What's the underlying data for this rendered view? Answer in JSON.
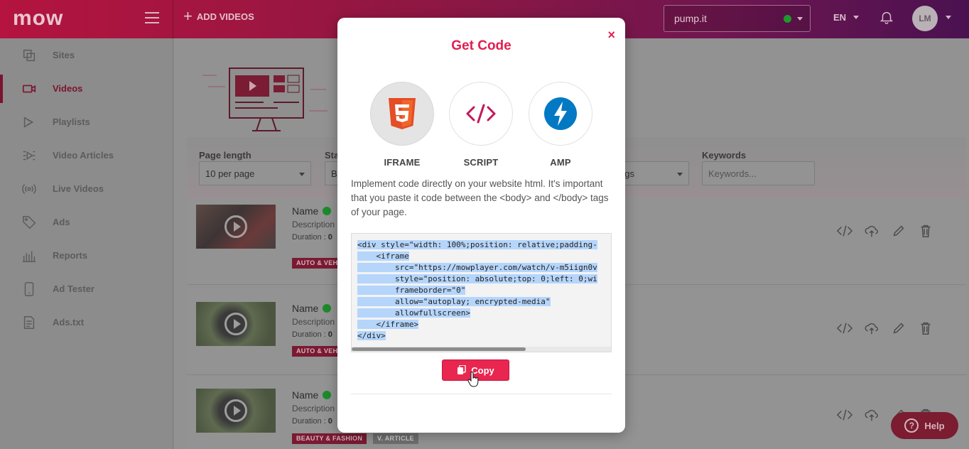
{
  "header": {
    "logo": "mow",
    "add_videos_label": "ADD VIDEOS",
    "site_select_value": "pump.it",
    "language": "EN",
    "avatar_initials": "LM"
  },
  "sidebar": {
    "items": [
      {
        "label": "Sites",
        "icon": "copy-icon"
      },
      {
        "label": "Videos",
        "icon": "video-camera-icon",
        "active": true
      },
      {
        "label": "Playlists",
        "icon": "playlist-icon"
      },
      {
        "label": "Video Articles",
        "icon": "article-icon"
      },
      {
        "label": "Live Videos",
        "icon": "broadcast-icon"
      },
      {
        "label": "Ads",
        "icon": "tag-icon"
      },
      {
        "label": "Reports",
        "icon": "bar-chart-icon"
      },
      {
        "label": "Ad Tester",
        "icon": "mobile-icon"
      },
      {
        "label": "Ads.txt",
        "icon": "document-icon"
      }
    ]
  },
  "filters": {
    "page_length_label": "Page length",
    "page_length_value": "10 per page",
    "status_label": "Sta",
    "status_value": "B",
    "tags_value": "ags",
    "keywords_label": "Keywords",
    "keywords_placeholder": "Keywords..."
  },
  "videos": [
    {
      "name": "Name",
      "description": "Description",
      "duration_label": "Duration :",
      "duration_value": "0",
      "tags": [
        "AUTO & VEH"
      ]
    },
    {
      "name": "Name",
      "description": "Description",
      "duration_label": "Duration :",
      "duration_value": "0",
      "tags": [
        "AUTO & VEH"
      ]
    },
    {
      "name": "Name",
      "description": "Description",
      "duration_label": "Duration :",
      "duration_value": "0",
      "tags": [
        "BEAUTY & FASHION",
        "V. ARTICLE"
      ]
    }
  ],
  "help_label": "Help",
  "modal": {
    "title": "Get Code",
    "close_label": "×",
    "options": [
      {
        "label": "IFRAME",
        "selected": true
      },
      {
        "label": "SCRIPT",
        "selected": false
      },
      {
        "label": "AMP",
        "selected": false
      }
    ],
    "description": "Implement code directly on your website html. It's important that you paste it code between the <body> and </body> tags of your page.",
    "code_lines": [
      "<div style=\"width: 100%;position: relative;padding-",
      "    <iframe",
      "        src=\"https://mowplayer.com/watch/v-m5iign0v",
      "        style=\"position: absolute;top: 0;left: 0;wi",
      "        frameborder=\"0\"",
      "        allow=\"autoplay; encrypted-media\"",
      "        allowfullscreen>",
      "    </iframe>",
      "</div>"
    ],
    "copy_label": "Copy"
  },
  "colors": {
    "accent": "#e0204f",
    "copy_button": "#e8264f",
    "selection": "#b5d5fb",
    "status_online": "#1d9a2b"
  }
}
